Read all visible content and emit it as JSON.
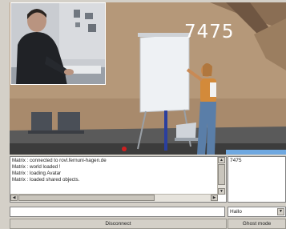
{
  "scene": {
    "overlay_number": "7475"
  },
  "log": {
    "lines": [
      "Matrix : connected to rovl.fernuni-hagen.de",
      "Matrix : world loaded !",
      "Matrix : loading Avatar",
      "Matrix : loaded shared objects."
    ]
  },
  "side_panel": {
    "text": "7475"
  },
  "chat": {
    "input_value": ""
  },
  "mode_select": {
    "selected": "Hallo"
  },
  "buttons": {
    "disconnect": "Disconnect",
    "ghost_mode": "Ghost mode"
  }
}
